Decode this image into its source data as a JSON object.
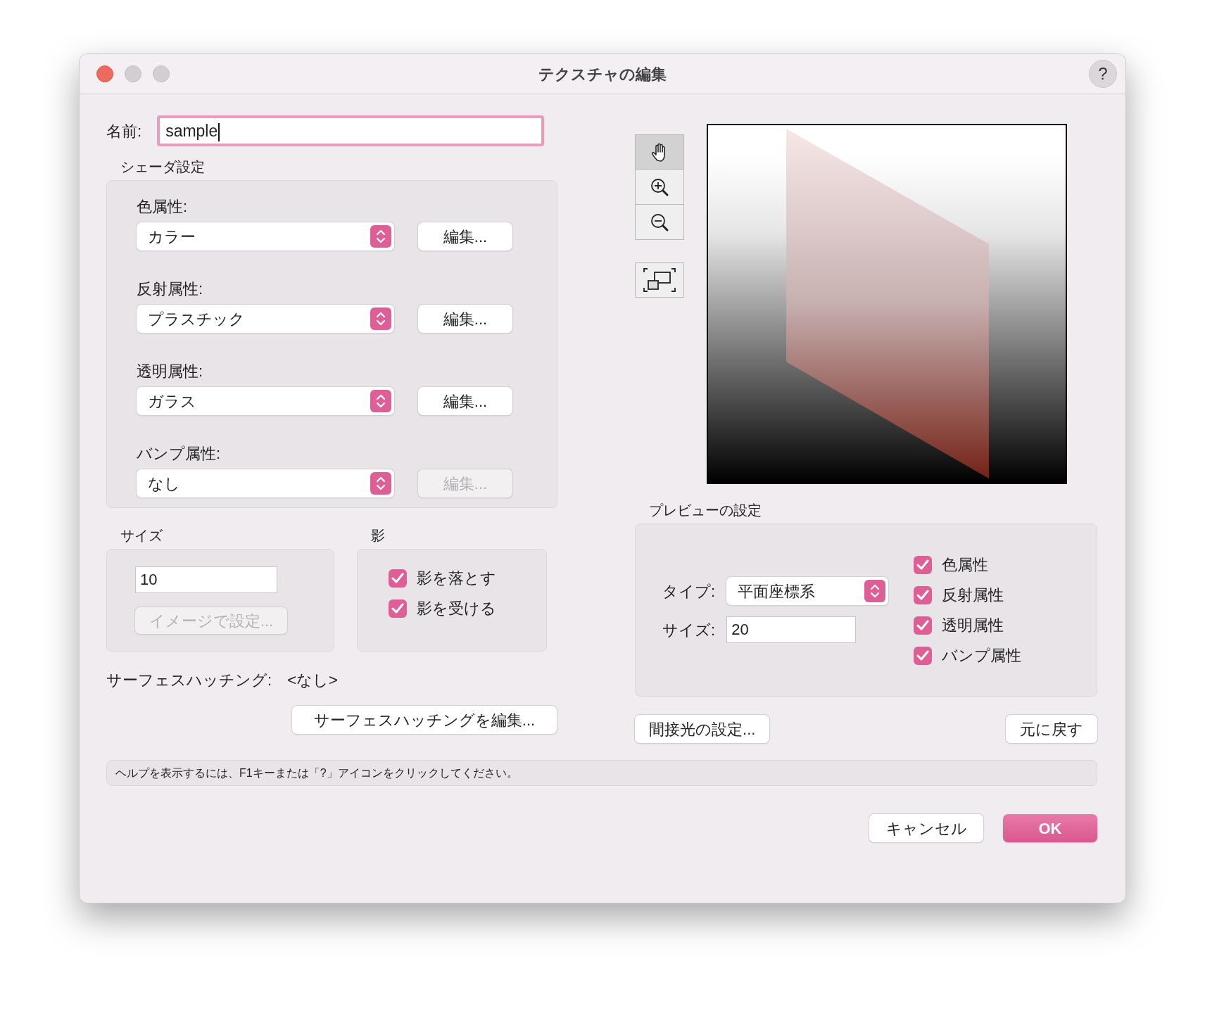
{
  "window": {
    "title": "テクスチャの編集",
    "help_button": "?"
  },
  "name_field": {
    "label": "名前:",
    "value": "sample"
  },
  "shader": {
    "title": "シェーダ設定",
    "rows": [
      {
        "label": "色属性:",
        "value": "カラー",
        "button": {
          "label": "編集...",
          "disabled": false
        }
      },
      {
        "label": "反射属性:",
        "value": "プラスチック",
        "button": {
          "label": "編集...",
          "disabled": false
        }
      },
      {
        "label": "透明属性:",
        "value": "ガラス",
        "button": {
          "label": "編集...",
          "disabled": false
        }
      },
      {
        "label": "バンプ属性:",
        "value": "なし",
        "button": {
          "label": "編集...",
          "disabled": true
        }
      }
    ]
  },
  "size": {
    "title": "サイズ",
    "value": "10",
    "button": {
      "label": "イメージで設定...",
      "disabled": true
    }
  },
  "shadow": {
    "title": "影",
    "options": [
      {
        "label": "影を落とす",
        "checked": true
      },
      {
        "label": "影を受ける",
        "checked": true
      }
    ]
  },
  "hatching": {
    "label": "サーフェスハッチング:",
    "value": "<なし>",
    "button": "サーフェスハッチングを編集..."
  },
  "preview_tools": [
    {
      "kind": "hand",
      "selected": true
    },
    {
      "kind": "zoom-in",
      "selected": false
    },
    {
      "kind": "zoom-out",
      "selected": false
    }
  ],
  "fit_tool": {
    "kind": "fit",
    "selected": false
  },
  "preview_settings": {
    "title": "プレビューの設定",
    "type_label": "タイプ:",
    "type_value": "平面座標系",
    "size_label": "サイズ:",
    "size_value": "20",
    "options": [
      {
        "label": "色属性",
        "checked": true
      },
      {
        "label": "反射属性",
        "checked": true
      },
      {
        "label": "透明属性",
        "checked": true
      },
      {
        "label": "バンプ属性",
        "checked": true
      }
    ]
  },
  "indirect_light_button": "間接光の設定...",
  "revert_button": "元に戻す",
  "help_text": "ヘルプを表示するには、F1キーまたは「?」アイコンをクリックしてください。",
  "footer_buttons": [
    {
      "label": "キャンセル",
      "kind": "normal"
    },
    {
      "label": "OK",
      "kind": "default"
    }
  ]
}
